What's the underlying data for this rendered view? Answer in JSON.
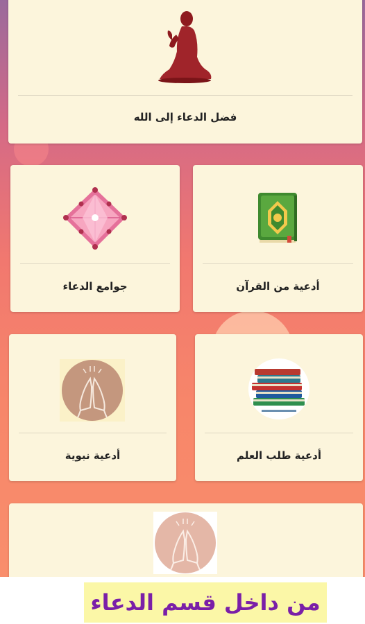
{
  "cards": {
    "fadl": {
      "label": "فضل الدعاء إلى الله",
      "icon": "praying-person-icon"
    },
    "quran": {
      "label": "أدعية من القرآن",
      "icon": "quran-book-icon"
    },
    "jawami": {
      "label": "جوامع الدعاء",
      "icon": "jeweled-diamond-icon"
    },
    "ilm": {
      "label": "أدعية طلب العلم",
      "icon": "stacked-books-icon"
    },
    "nabawiya": {
      "label": "أدعية نبوية",
      "icon": "praying-hands-icon"
    },
    "bottom": {
      "label": "",
      "icon": "praying-hands-icon"
    }
  },
  "caption": "من داخل قسم الدعاء",
  "colors": {
    "card_background": "#fcf5dc",
    "caption_text": "#7a1fa8",
    "caption_background": "#fbf7a7"
  }
}
